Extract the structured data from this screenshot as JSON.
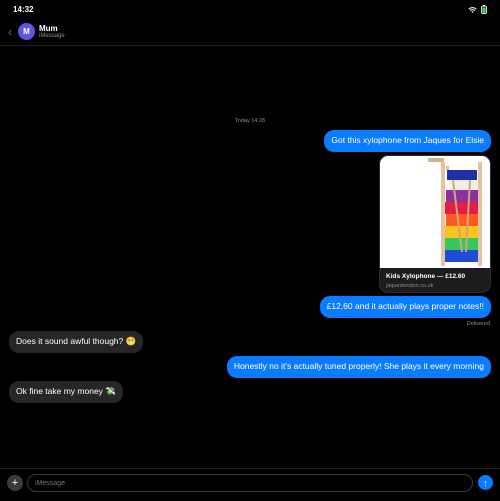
{
  "status_bar": {
    "time": "14:32",
    "icons": [
      "wifi-icon",
      "battery-icon"
    ]
  },
  "header": {
    "back_icon": "chevron-left-icon",
    "avatar_initial": "M",
    "name": "Mum",
    "service": "iMessage"
  },
  "conversation": {
    "timestamp": "Today 14:28",
    "messages": [
      {
        "direction": "outgoing",
        "text": "Got this xylophone from Jaques for Elsie"
      },
      {
        "direction": "outgoing",
        "type": "link_preview",
        "title": "Kids Xylophone — £12.60",
        "domain": "jaqueslondon.co.uk"
      },
      {
        "direction": "outgoing",
        "text": "£12.60 and it actually plays proper notes!!"
      },
      {
        "direction": "incoming",
        "text": "Does it sound awful though? 😬"
      },
      {
        "direction": "outgoing",
        "text": "Honestly no it's actually tuned properly! She plays it every morning"
      },
      {
        "direction": "incoming",
        "text": "Ok fine take my money 💸"
      }
    ],
    "delivered_label": "Delivered"
  },
  "composer": {
    "placeholder": "iMessage",
    "plus_icon": "plus-icon",
    "send_icon": "arrow-up-icon"
  },
  "colors": {
    "outgoing_bubble": "#0b7cff",
    "incoming_bubble": "#262628",
    "background": "#000000",
    "accent": "#2f7cf6"
  }
}
